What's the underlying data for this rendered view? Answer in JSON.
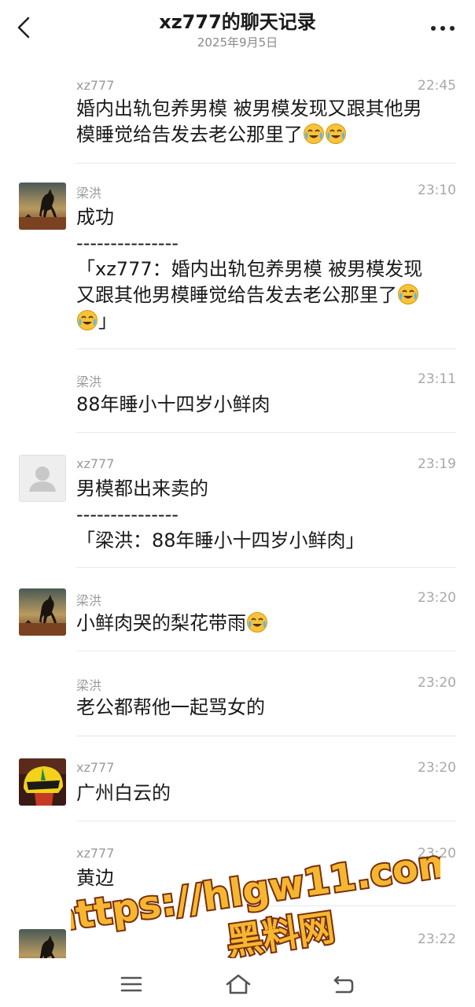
{
  "header": {
    "title": "xz777的聊天记录",
    "date": "2025年9月5日"
  },
  "messages": [
    {
      "sender": "xz777",
      "time": "22:45",
      "avatar": "none",
      "text_line1": "婚内出轨包养男模 被男模发现又跟其他男",
      "text_line2": "模睡觉给告发去老公那里了"
    },
    {
      "sender": "梁洪",
      "time": "23:10",
      "avatar": "horse",
      "text": "成功",
      "separator": "---------------",
      "quote_line1": "「xz777：婚内出轨包养男模 被男模发现",
      "quote_line2": "又跟其他男模睡觉给告发去老公那里了",
      "quote_close": "」"
    },
    {
      "sender": "梁洪",
      "time": "23:11",
      "avatar": "none",
      "text": "88年睡小十四岁小鲜肉"
    },
    {
      "sender": "xz777",
      "time": "23:19",
      "avatar": "default",
      "text": "男模都出来卖的",
      "separator": "---------------",
      "quote": "「梁洪：88年睡小十四岁小鲜肉」"
    },
    {
      "sender": "梁洪",
      "time": "23:20",
      "avatar": "horse",
      "text": "小鲜肉哭的梨花带雨"
    },
    {
      "sender": "梁洪",
      "time": "23:20",
      "avatar": "none",
      "text": "老公都帮他一起骂女的"
    },
    {
      "sender": "xz777",
      "time": "23:20",
      "avatar": "helmet",
      "text": "广州白云的"
    },
    {
      "sender": "xz777",
      "time": "23:20",
      "avatar": "none",
      "text": "黄边"
    },
    {
      "sender": "",
      "time": "23:22",
      "avatar": "horse",
      "text": ""
    }
  ],
  "watermark": {
    "line1": "https://hlgw11.com",
    "line2": "黑料网"
  },
  "nav": [
    "menu-icon",
    "home-icon",
    "back-icon"
  ],
  "colors": {
    "text": "#1a1a1a",
    "meta": "#9a9a9a",
    "divider": "#e8e8e8",
    "watermark_fill": "#f5b731",
    "watermark_stroke": "#7a2f0a"
  }
}
